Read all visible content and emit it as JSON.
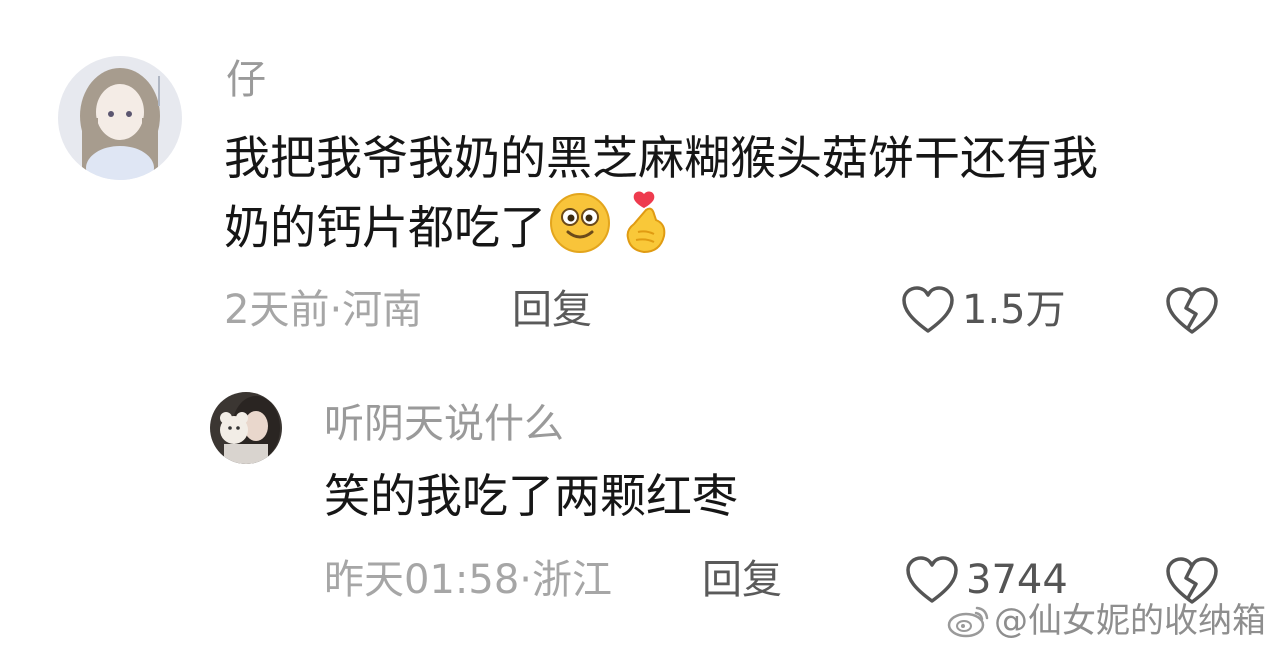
{
  "comments": [
    {
      "username": "仔",
      "content_line1": "我把我爷我奶的黑芝麻糊猴头菇饼干还有我",
      "content_line2": "奶的钙片都吃了",
      "emojis": [
        "smiling-face-emoji",
        "finger-heart-emoji"
      ],
      "meta": "2天前·河南",
      "reply_label": "回复",
      "likes": "1.5万"
    },
    {
      "username": "听阴天说什么",
      "content_line1": "笑的我吃了两颗红枣",
      "meta": "昨天01:58·浙江",
      "reply_label": "回复",
      "likes": "3744"
    }
  ],
  "watermark": {
    "text": "@仙女妮的收纳箱",
    "icon": "weibo-logo"
  },
  "colors": {
    "username": "#9a9a9a",
    "content": "#161616",
    "meta": "#a6a6a6",
    "reply": "#5a5a5a",
    "icon": "#555555"
  }
}
